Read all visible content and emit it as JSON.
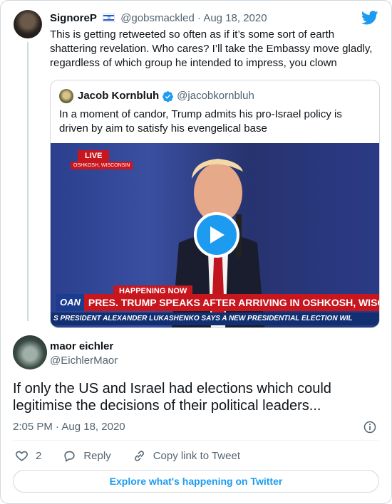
{
  "parent_tweet": {
    "display_name": "SignoreP",
    "flag_icon": "israel-flag-icon",
    "handle": "@gobsmackled",
    "separator": "·",
    "date": "Aug 18, 2020",
    "text": "This is getting retweeted so often as if it’s some sort of earth\nshattering revelation. Who cares? I’ll take the Embassy move gladly,\nregardless of which group he intended to impress, you clown"
  },
  "quoted_tweet": {
    "display_name": "Jacob Kornbluh",
    "verified_icon": "verified-badge-icon",
    "handle": "@jacobkornbluh",
    "text": "In a moment of candor, Trump admits his pro-Israel policy is driven by aim to satisfy his evengelical base",
    "video": {
      "live_tag": "LIVE",
      "location_tag": "OSHKOSH, WISCONSIN",
      "happening_tag": "HAPPENING NOW",
      "network": "OAN",
      "headline": "PRES. TRUMP SPEAKS AFTER ARRIVING IN OSHKOSH, WISC.",
      "ticker": "S PRESIDENT ALEXANDER LUKASHENKO SAYS A NEW PRESIDENTIAL ELECTION WIL",
      "play_icon": "play-icon"
    }
  },
  "main_tweet": {
    "display_name": "maor eichler",
    "handle": "@EichlerMaor",
    "text": "If only the US and Israel had elections which could legitimise the decisions of their political leaders...",
    "time": "2:05 PM",
    "separator": "·",
    "date": "Aug 18, 2020",
    "like_count": "2",
    "reply_label": "Reply",
    "copy_link_label": "Copy link to Tweet"
  },
  "explore_label": "Explore what's happening on Twitter",
  "colors": {
    "accent": "#1d9bf0",
    "muted": "#536471",
    "border": "#cfd9de"
  }
}
